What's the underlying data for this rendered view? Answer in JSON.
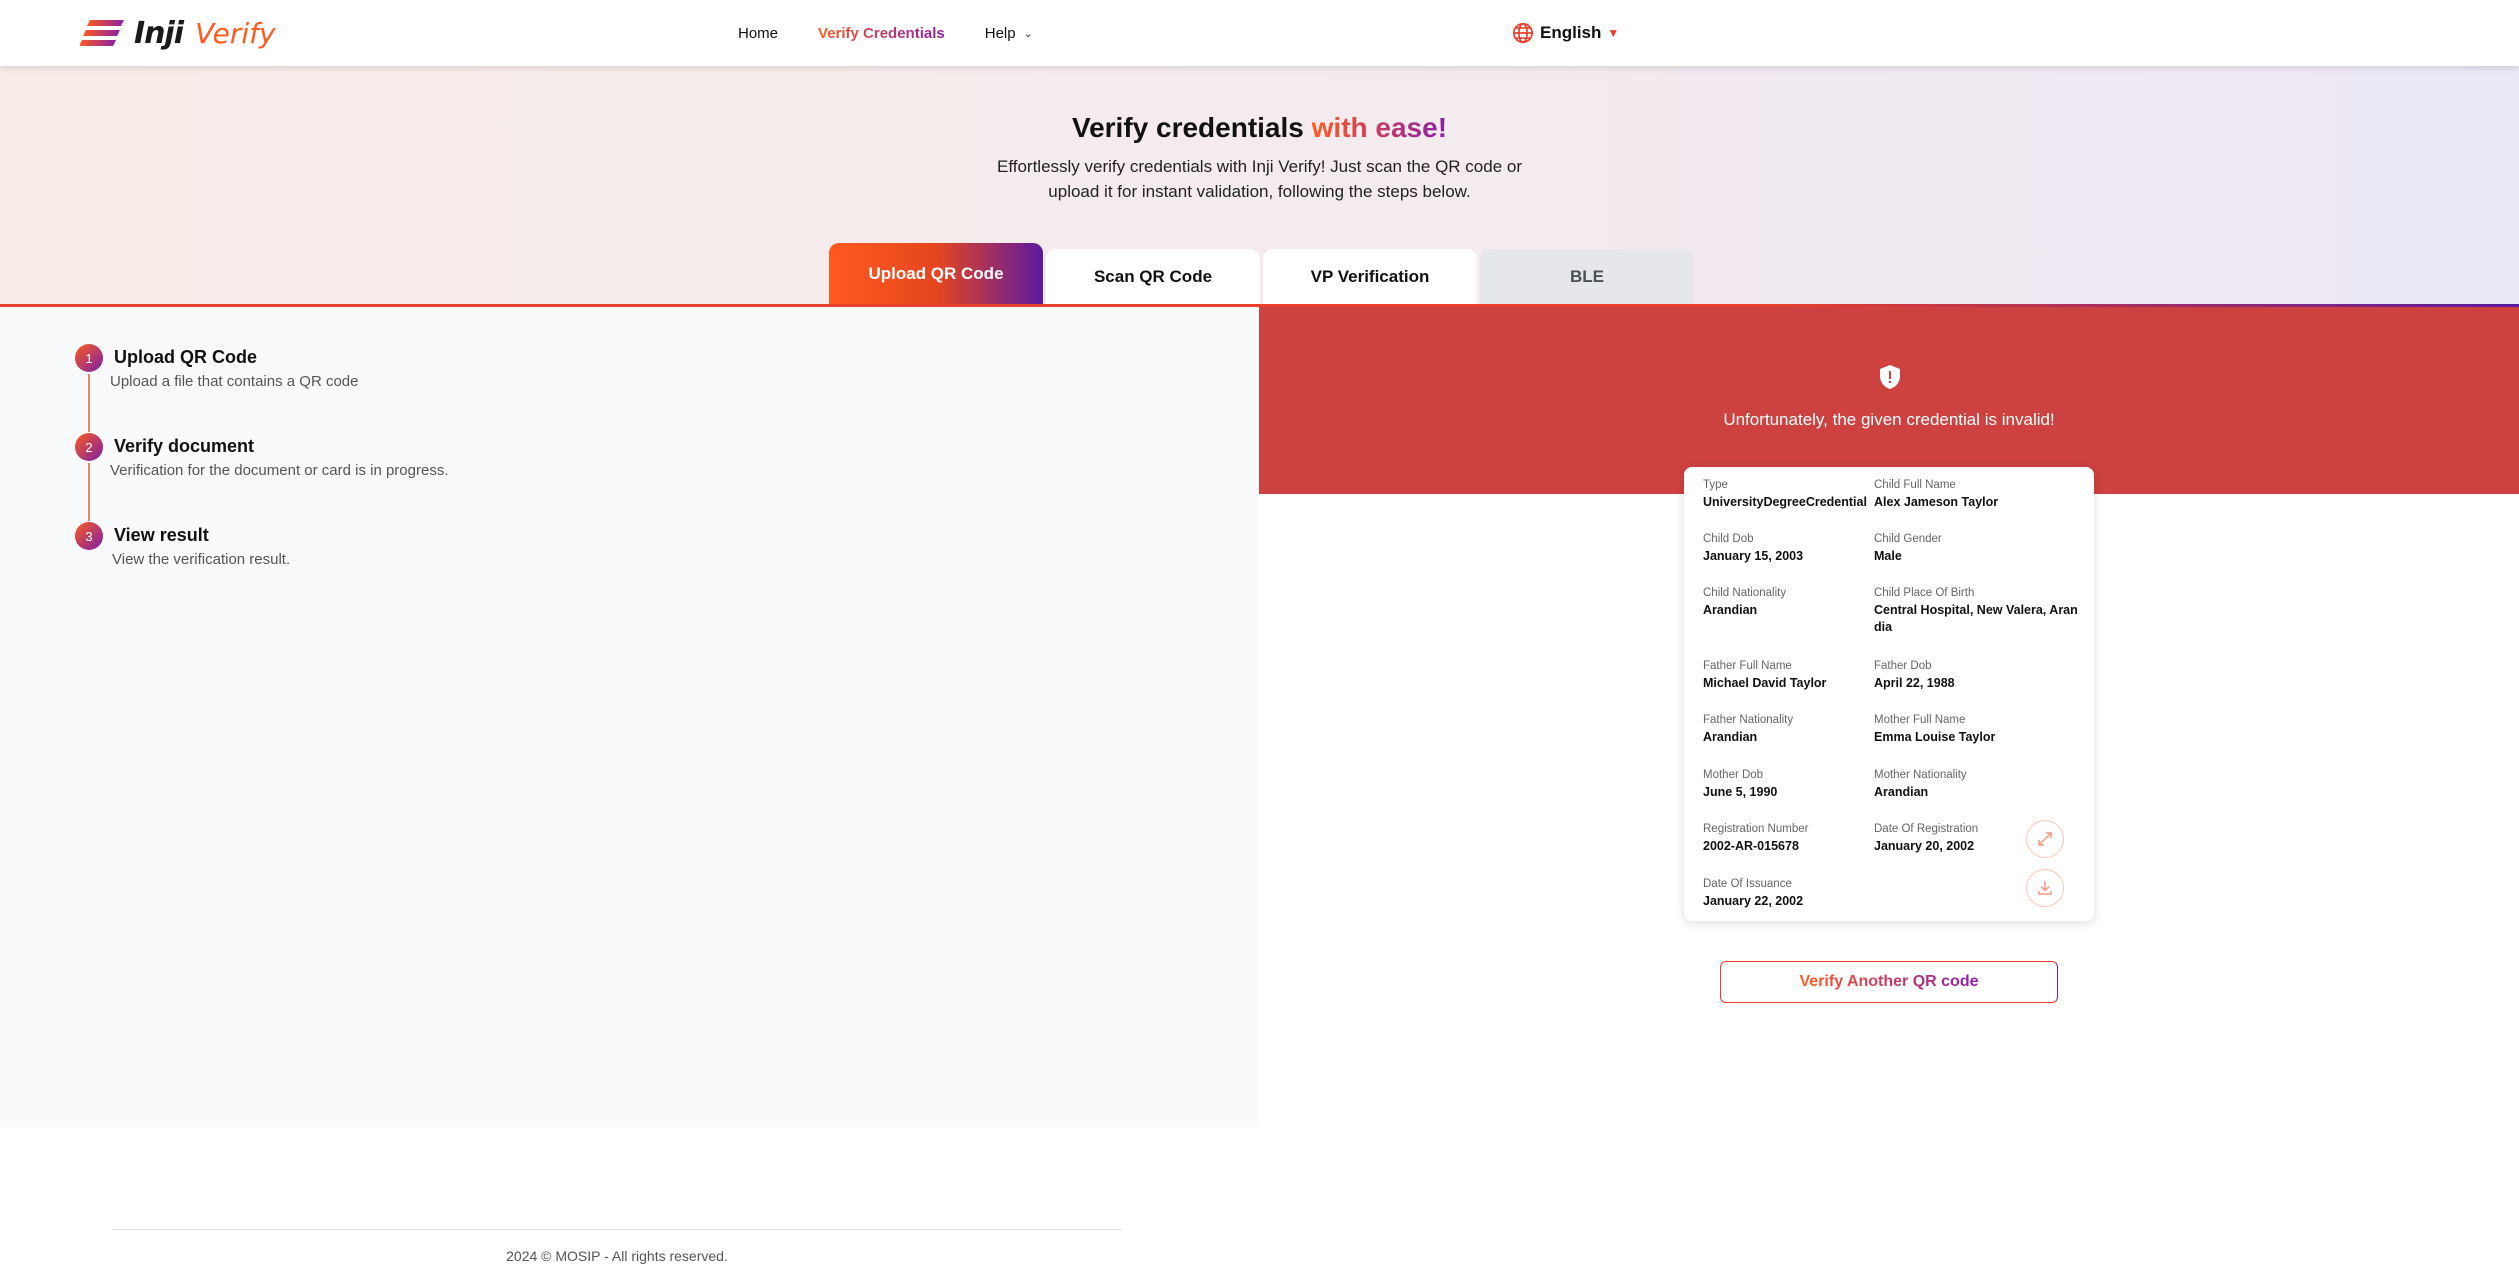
{
  "header": {
    "logo_inji": "Inji",
    "logo_verify": "Verify",
    "nav": [
      {
        "label": "Home"
      },
      {
        "label": "Verify Credentials"
      },
      {
        "label": "Help"
      }
    ],
    "language": "English"
  },
  "hero": {
    "title_main": "Verify credentials",
    "title_accent": "with ease!",
    "subtitle_line1": "Effortlessly verify credentials with Inji Verify! Just scan the QR code or",
    "subtitle_line2": "upload it for instant validation, following the steps below."
  },
  "tabs": [
    {
      "label": "Upload QR Code"
    },
    {
      "label": "Scan QR Code"
    },
    {
      "label": "VP Verification"
    },
    {
      "label": "BLE"
    }
  ],
  "steps": [
    {
      "num": "1",
      "title": "Upload QR Code",
      "desc": "Upload a file that contains a QR code"
    },
    {
      "num": "2",
      "title": "Verify document",
      "desc": "Verification for the document or card is in progress."
    },
    {
      "num": "3",
      "title": "View result",
      "desc": "View the verification result."
    }
  ],
  "result": {
    "message": "Unfortunately, the given credential is invalid!",
    "status_color": "#cd4241",
    "fields": [
      {
        "label": "Type",
        "value": "UniversityDegreeCredential"
      },
      {
        "label": "Child Full Name",
        "value": "Alex Jameson Taylor"
      },
      {
        "label": "Child Dob",
        "value": "January 15, 2003"
      },
      {
        "label": "Child Gender",
        "value": "Male"
      },
      {
        "label": "Child Nationality",
        "value": "Arandian"
      },
      {
        "label": "Child Place Of Birth",
        "value": "Central Hospital, New Valera, Arandia"
      },
      {
        "label": "Father Full Name",
        "value": "Michael David Taylor"
      },
      {
        "label": "Father Dob",
        "value": "April 22, 1988"
      },
      {
        "label": "Father Nationality",
        "value": "Arandian"
      },
      {
        "label": "Mother Full Name",
        "value": "Emma Louise Taylor"
      },
      {
        "label": "Mother Dob",
        "value": "June 5, 1990"
      },
      {
        "label": "Mother Nationality",
        "value": "Arandian"
      },
      {
        "label": "Registration Number",
        "value": "2002-AR-015678"
      },
      {
        "label": "Date Of Registration",
        "value": "January 20, 2002"
      },
      {
        "label": "Date Of Issuance",
        "value": "January 22, 2002"
      }
    ],
    "verify_again_label": "Verify Another QR code"
  },
  "footer": {
    "text": "2024 © MOSIP - All rights reserved."
  },
  "icons": {
    "logo": "inji-logo-icon",
    "language": "globe-icon",
    "banner": "shield-alert-icon",
    "expand": "expand-icon",
    "download": "download-icon"
  }
}
